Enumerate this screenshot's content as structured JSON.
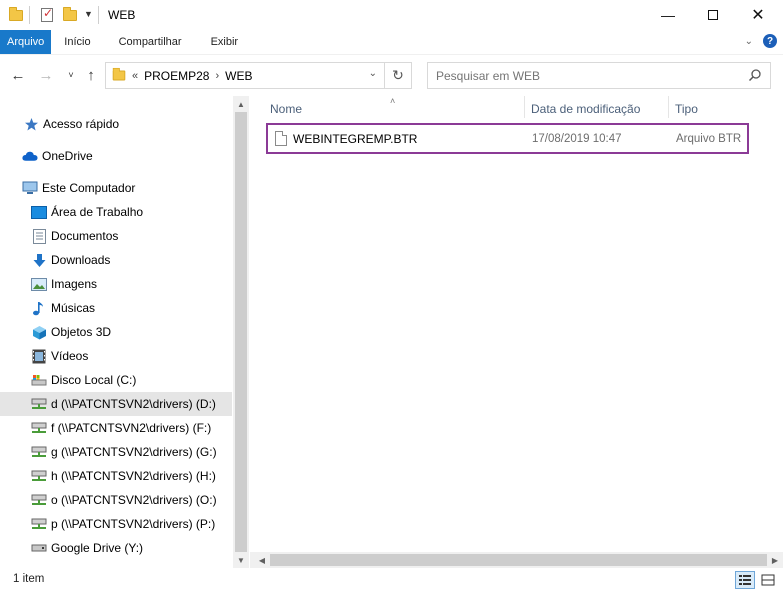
{
  "titlebar": {
    "title": "WEB",
    "minimize_icon": "minimize-icon",
    "maximize_icon": "maximize-icon",
    "close_icon": "close-icon"
  },
  "ribbon": {
    "tabs": [
      {
        "label": "Arquivo",
        "active": true
      },
      {
        "label": "Início"
      },
      {
        "label": "Compartilhar"
      },
      {
        "label": "Exibir"
      }
    ],
    "accent": "#1979ca"
  },
  "nav": {
    "breadcrumbs": [
      "PROEMP28",
      "WEB"
    ],
    "overflow_marker": "«"
  },
  "search": {
    "placeholder": "Pesquisar em WEB"
  },
  "sidebar": {
    "items": [
      {
        "label": "Acesso rápido",
        "icon": "star-icon"
      },
      {
        "label": "OneDrive",
        "icon": "cloud-icon"
      },
      {
        "label": "Este Computador",
        "icon": "computer-icon"
      },
      {
        "label": "Área de Trabalho",
        "icon": "desktop-icon"
      },
      {
        "label": "Documentos",
        "icon": "documents-icon"
      },
      {
        "label": "Downloads",
        "icon": "download-icon"
      },
      {
        "label": "Imagens",
        "icon": "pictures-icon"
      },
      {
        "label": "Músicas",
        "icon": "music-icon"
      },
      {
        "label": "Objetos 3D",
        "icon": "cube-icon"
      },
      {
        "label": "Vídeos",
        "icon": "video-icon"
      },
      {
        "label": "Disco Local (C:)",
        "icon": "disk-icon"
      },
      {
        "label": "d (\\\\PATCNTSVN2\\drivers) (D:)",
        "icon": "network-drive-icon",
        "selected": true
      },
      {
        "label": "f (\\\\PATCNTSVN2\\drivers) (F:)",
        "icon": "network-drive-icon"
      },
      {
        "label": "g (\\\\PATCNTSVN2\\drivers) (G:)",
        "icon": "network-drive-icon"
      },
      {
        "label": "h (\\\\PATCNTSVN2\\drivers) (H:)",
        "icon": "network-drive-icon"
      },
      {
        "label": "o (\\\\PATCNTSVN2\\drivers) (O:)",
        "icon": "network-drive-icon"
      },
      {
        "label": "p (\\\\PATCNTSVN2\\drivers) (P:)",
        "icon": "network-drive-icon"
      },
      {
        "label": "Google Drive (Y:)",
        "icon": "drive-icon"
      }
    ]
  },
  "columns": {
    "name": "Nome",
    "date": "Data de modificação",
    "type": "Tipo"
  },
  "files": [
    {
      "name": "WEBINTEGREMP.BTR",
      "date": "17/08/2019 10:47",
      "type": "Arquivo BTR",
      "highlight_color": "#8b3a96"
    }
  ],
  "status": {
    "count": "1 item"
  }
}
